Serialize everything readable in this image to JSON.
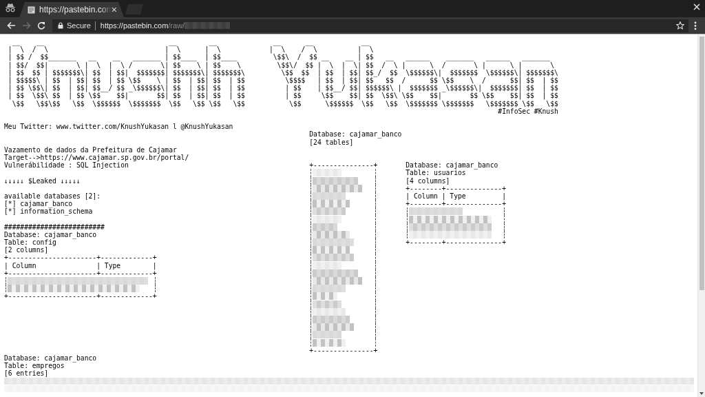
{
  "browser": {
    "tabs": [
      {
        "title": "https://pastebin.com",
        "selected": true
      }
    ],
    "omnibox": {
      "security": "Secure",
      "url_host": "https://pastebin.com",
      "url_path": "/raw/"
    }
  },
  "paste": {
    "banner": {
      "left_lines": [
        "  __    __                               __        __",
        " |  \\  /  \\                             |  \\      |  \\",
        " | $$ /  $$_______   __    __   _______ | $$____  | $$____",
        " | $$/  $$|       \\ |  \\  |  \\ /       \\| $$    \\ | $$    \\",
        " | $$  $$ | $$$$$$$\\| $$  | $$|  $$$$$$$| $$$$$$$\\| $$$$$$$\\",
        " | $$$$$\\ | $$  | $$| $$  | $$ \\$$    \\ | $$  | $$| $$  | $$",
        " | $$ \\$$\\| $$  | $$| $$__/ $$ _\\$$$$$$\\| $$  | $$| $$  | $$",
        " | $$  \\$$\\ $$  | $$ \\$$    $$|       $$| $$  | $$| $$  | $$",
        "  \\$$   \\$$\\$$   \\$$  \\$$$$$$  \\$$$$$$$  \\$$   \\$$ \\$$   \\$$"
      ],
      "right_lines": [
        " __      __            __",
        "|  \\    /  \\          |  \\",
        " \\$$\\  /  $$ __    __ | $$   __   ______    _______   ______   _______",
        "  \\$$\\/  $$ |  \\  |  \\| $$  /  \\ |      \\  /       \\ |      \\ |       \\",
        "   \\$$  $$  | $$  | $$| $$_/  $$  \\$$$$$$\\|  $$$$$$$  \\$$$$$$\\| $$$$$$$\\",
        "    \\$$$$   | $$  | $$| $$   $$  /      $$ \\$$    \\  /      $$| $$  | $$",
        "    | $$    | $$__/ $$| $$$$$$\\ |  $$$$$$$ _\\$$$$$$\\|  $$$$$$$| $$  | $$",
        "    | $$     \\$$    $$| $$  \\$$\\ \\$$    $$|       $$ \\$$    $$| $$  | $$",
        "     \\$$      \\$$$$$$  \\$$   \\$$  \\$$$$$$$ \\$$$$$$$   \\$$$$$$$ \\$$   \\$$"
      ],
      "tags": "#InfoSec #Knush"
    },
    "columns": [
      {
        "items": [
          {
            "kind": "text",
            "text": "Meu Twitter: www.twitter.com/KnushYukasan l @KnushYukasan"
          },
          {
            "kind": "blank"
          },
          {
            "kind": "blank"
          },
          {
            "kind": "text",
            "text": "Vazamento de dados da Prefeitura de Cajamar"
          },
          {
            "kind": "text",
            "text": "Target-->https://www.cajamar.sp.gov.br/portal/"
          },
          {
            "kind": "text",
            "text": "Vulnerábilidade : SQL Injection"
          },
          {
            "kind": "blank"
          },
          {
            "kind": "text",
            "text": "↓↓↓↓↓ $Leaked ↓↓↓↓↓"
          },
          {
            "kind": "blank"
          },
          {
            "kind": "text",
            "text": "available databases [2]:"
          },
          {
            "kind": "text",
            "text": "[*] cajamar_banco"
          },
          {
            "kind": "text",
            "text": "[*] information_schema"
          },
          {
            "kind": "blank"
          },
          {
            "kind": "text",
            "text": "#########################"
          },
          {
            "kind": "text",
            "text": "Database: cajamar_banco"
          },
          {
            "kind": "text",
            "text": "Table: config"
          },
          {
            "kind": "text",
            "text": "[2 columns]"
          },
          {
            "kind": "table",
            "top": "+----------------------+-------------+",
            "header": "| Column               | Type        |",
            "rule": "+----------------------+-------------+",
            "rows": [
              {
                "kind": "redacted"
              },
              {
                "kind": "redacted"
              }
            ],
            "bottom": "+----------------------+-------------+"
          }
        ]
      },
      {
        "items": [
          {
            "kind": "blank"
          },
          {
            "kind": "text",
            "text": "Database: cajamar_banco"
          },
          {
            "kind": "text",
            "text": "[24 tables]"
          },
          {
            "kind": "blank"
          },
          {
            "kind": "blank"
          },
          {
            "kind": "table",
            "top": "+---------------+",
            "rows": [
              {
                "kind": "redacted"
              },
              {
                "kind": "redacted"
              },
              {
                "kind": "redacted"
              },
              {
                "kind": "redacted"
              },
              {
                "kind": "redacted"
              },
              {
                "kind": "redacted"
              },
              {
                "kind": "redacted"
              },
              {
                "kind": "redacted"
              },
              {
                "kind": "redacted"
              },
              {
                "kind": "redacted"
              },
              {
                "kind": "redacted"
              },
              {
                "kind": "redacted"
              },
              {
                "kind": "redacted"
              },
              {
                "kind": "redacted"
              },
              {
                "kind": "redacted"
              },
              {
                "kind": "redacted"
              },
              {
                "kind": "redacted"
              },
              {
                "kind": "redacted"
              },
              {
                "kind": "redacted"
              },
              {
                "kind": "redacted"
              },
              {
                "kind": "redacted"
              },
              {
                "kind": "redacted"
              },
              {
                "kind": "redacted"
              }
            ],
            "bottom": "+---------------+"
          }
        ]
      },
      {
        "items": [
          {
            "kind": "blank"
          },
          {
            "kind": "blank"
          },
          {
            "kind": "blank"
          },
          {
            "kind": "blank"
          },
          {
            "kind": "blank"
          },
          {
            "kind": "text",
            "text": "Database: cajamar_banco"
          },
          {
            "kind": "text",
            "text": "Table: usuarios"
          },
          {
            "kind": "text",
            "text": "[4 columns]"
          },
          {
            "kind": "table",
            "top": "+--------+--------------+",
            "header": "| Column | Type         |",
            "rule": "+--------+--------------+",
            "rows": [
              {
                "kind": "redacted"
              },
              {
                "kind": "redacted"
              },
              {
                "kind": "redacted"
              },
              {
                "kind": "redacted"
              }
            ],
            "bottom": "+--------+--------------+"
          }
        ]
      }
    ],
    "footer": {
      "items": [
        {
          "kind": "text",
          "text": "Database: cajamar_banco"
        },
        {
          "kind": "text",
          "text": "Table: empregos"
        },
        {
          "kind": "text",
          "text": "[6 entries]"
        },
        {
          "kind": "redacted_line"
        },
        {
          "kind": "redacted_line"
        }
      ]
    }
  }
}
